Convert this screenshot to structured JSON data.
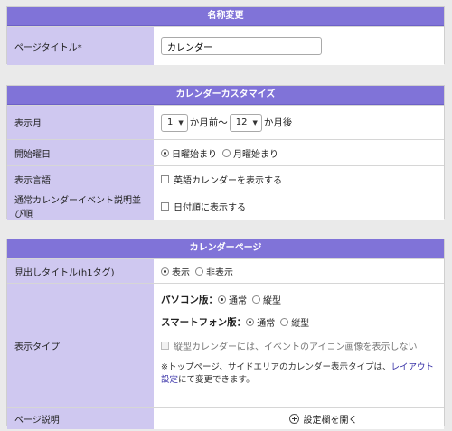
{
  "name_change": {
    "header": "名称変更",
    "page_title_label": "ページタイトル*",
    "page_title_value": "カレンダー"
  },
  "customize": {
    "header": "カレンダーカスタマイズ",
    "display_month_label": "表示月",
    "month_before_value": "1",
    "month_before_suffix": "か月前〜",
    "month_after_value": "12",
    "month_after_suffix": "か月後",
    "start_day_label": "開始曜日",
    "sunday_label": "日曜始まり",
    "monday_label": "月曜始まり",
    "language_label": "表示言語",
    "english_label": "英語カレンダーを表示する",
    "event_order_label": "通常カレンダーイベント説明並び順",
    "date_order_label": "日付順に表示する"
  },
  "calendar_page": {
    "header": "カレンダーページ",
    "heading_title_label": "見出しタイトル(h1タグ)",
    "show_label": "表示",
    "hide_label": "非表示",
    "display_type_label": "表示タイプ",
    "pc_label": "パソコン版：",
    "pc_normal": "通常",
    "pc_vertical": "縦型",
    "sp_label": "スマートフォン版：",
    "sp_normal": "通常",
    "sp_vertical": "縦型",
    "vertical_icon_note": "縦型カレンダーには、イベントのアイコン画像を表示しない",
    "note_prefix": "※トップページ、サイドエリアのカレンダー表示タイプは、",
    "note_link": "レイアウト設定",
    "note_suffix": "にて変更できます。",
    "description_label": "ページ説明",
    "open_settings": "設定欄を開く"
  }
}
